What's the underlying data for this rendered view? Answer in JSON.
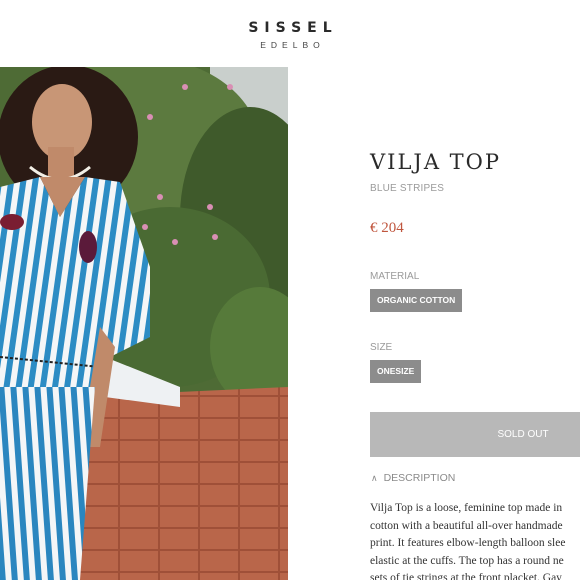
{
  "brand": {
    "name": "SISSEL",
    "subname": "EDELBO"
  },
  "product": {
    "title": "VILJA TOP",
    "variant": "BLUE STRIPES",
    "price": "€ 204",
    "material_label": "MATERIAL",
    "material_value": "ORGANIC COTTON",
    "size_label": "SIZE",
    "size_value": "ONESIZE",
    "sold_out_label": "SOLD OUT",
    "description_label": "DESCRIPTION",
    "description_lines": [
      "Vilja Top is a loose, feminine top made in",
      "cotton with a beautiful all-over handmade",
      "print. It features elbow-length balloon slee",
      "elastic at the cuffs. The top has a round ne",
      "sets of tie strings at the front placket. Gay"
    ]
  },
  "colors": {
    "price": "#c0563e",
    "chip_bg": "#8c8c8c",
    "sold_out_bg": "#b8b8b8",
    "muted_text": "#9a9a9a"
  },
  "icons": {
    "description_toggle": "chevron-up-icon"
  }
}
